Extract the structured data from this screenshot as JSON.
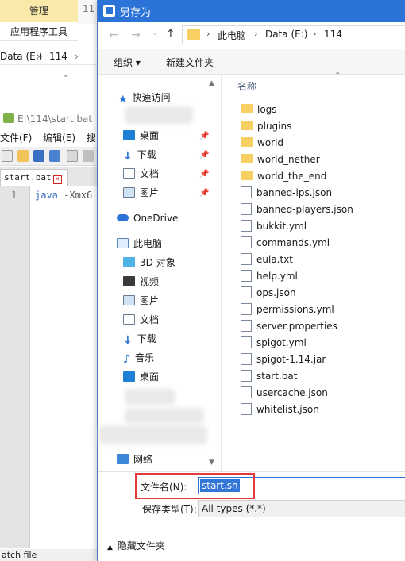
{
  "background_explorer": {
    "ribbon_tab_manage": "管理",
    "ribbon_tab_partial": "11",
    "ribbon_app_tools": "应用程序工具",
    "address": [
      "Data (E:)",
      "114"
    ]
  },
  "notepad": {
    "title": "E:\\114\\start.bat -",
    "menu": [
      "文件(F)",
      "编辑(E)",
      "搜索"
    ],
    "tab_label": "start.bat",
    "line_number": "1",
    "code_keyword": "java",
    "code_rest": " -Xmx6",
    "status": "atch file"
  },
  "dialog": {
    "title": "另存为",
    "breadcrumb": [
      "此电脑",
      "Data (E:)",
      "114"
    ],
    "organize_label": "组织 ▾",
    "new_folder_label": "新建文件夹",
    "nav": {
      "quick_access": "快速访问",
      "desktop": "桌面",
      "downloads": "下载",
      "documents": "文档",
      "pictures": "图片",
      "onedrive": "OneDrive",
      "this_pc": "此电脑",
      "objects3d": "3D 对象",
      "videos": "视频",
      "pictures2": "图片",
      "documents2": "文档",
      "downloads2": "下载",
      "music": "音乐",
      "desktop2": "桌面",
      "network": "网络"
    },
    "column_name": "名称",
    "files": [
      {
        "name": "logs",
        "type": "folder"
      },
      {
        "name": "plugins",
        "type": "folder"
      },
      {
        "name": "world",
        "type": "folder"
      },
      {
        "name": "world_nether",
        "type": "folder"
      },
      {
        "name": "world_the_end",
        "type": "folder"
      },
      {
        "name": "banned-ips.json",
        "type": "file"
      },
      {
        "name": "banned-players.json",
        "type": "file"
      },
      {
        "name": "bukkit.yml",
        "type": "file"
      },
      {
        "name": "commands.yml",
        "type": "file"
      },
      {
        "name": "eula.txt",
        "type": "file"
      },
      {
        "name": "help.yml",
        "type": "file"
      },
      {
        "name": "ops.json",
        "type": "file"
      },
      {
        "name": "permissions.yml",
        "type": "file"
      },
      {
        "name": "server.properties",
        "type": "file"
      },
      {
        "name": "spigot.yml",
        "type": "file"
      },
      {
        "name": "spigot-1.14.jar",
        "type": "file"
      },
      {
        "name": "start.bat",
        "type": "file"
      },
      {
        "name": "usercache.json",
        "type": "file"
      },
      {
        "name": "whitelist.json",
        "type": "file"
      }
    ],
    "filename_label": "文件名(N):",
    "filename_value": "start.sh",
    "filetype_label": "保存类型(T):",
    "filetype_value": "All types (*.*)",
    "hide_folders_label": "隐藏文件夹"
  },
  "colors": {
    "titlebar": "#2b73d6",
    "highlight_box": "#e23b3b",
    "folder": "#f7cf62"
  }
}
